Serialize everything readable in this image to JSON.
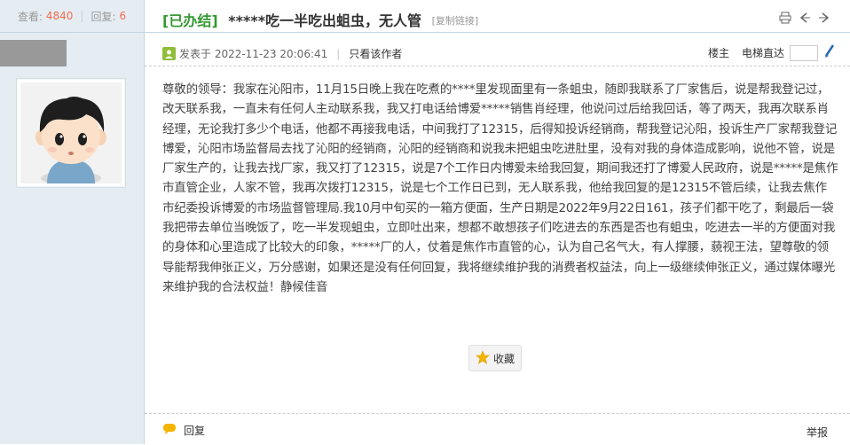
{
  "stats": {
    "views_label": "查看:",
    "views_count": "4840",
    "replies_label": "回复:",
    "replies_count": "6"
  },
  "thread": {
    "status_tag": "[已办结]",
    "title": "*****吃一半吃出蛆虫，无人管",
    "copy_link": "[复制链接]"
  },
  "post_meta": {
    "posted_at": "发表于 2022-11-23 20:06:41",
    "only_author": "只看该作者",
    "floor_owner": "楼主",
    "elevator": "电梯直达"
  },
  "post": {
    "body": "尊敬的领导：我家在沁阳市，11月15日晚上我在吃煮的****里发现面里有一条蛆虫，随即我联系了厂家售后，说是帮我登记过，改天联系我，一直未有任何人主动联系我，我又打电话给博爱*****销售肖经理，他说问过后给我回话，等了两天，我再次联系肖经理，无论我打多少个电话，他都不再接我电话，中间我打了12315，后得知投诉经销商，帮我登记沁阳，投诉生产厂家帮我登记博爱，沁阳市场监督局去找了沁阳的经销商，沁阳的经销商和说我未把蛆虫吃进肚里，没有对我的身体造成影响，说他不管，说是厂家生产的，让我去找厂家，我又打了12315，说是7个工作日内博爱未给我回复，期间我还打了博爱人民政府，说是*****是焦作市直管企业，人家不管，我再次拨打12315，说是七个工作日已到，无人联系我，他给我回复的是12315不管后续，让我去焦作市纪委投诉博爱的市场监督管理局.我10月中旬买的一箱方便面，生产日期是2022年9月22日161，孩子们都干吃了，剩最后一袋我把带去单位当晚饭了，吃一半发现蛆虫，立即吐出来，想都不敢想孩子们吃进去的东西是否也有蛆虫，吃进去一半的方便面对我的身体和心里造成了比较大的印象，*****厂的人，仗着是焦作市直管的心，认为自己名气大，有人撑腰，藐视王法，望尊敬的领导能帮我伸张正义，万分感谢，如果还是没有任何回复，我将继续维护我的消费者权益法，向上一级继续伸张正义，通过媒体曝光来维护我的合法权益！静候佳音"
  },
  "actions": {
    "favorite": "收藏",
    "reply": "回复",
    "report": "举报"
  },
  "colors": {
    "accent_green": "#339933",
    "count_orange": "#f26c4f",
    "sidebar_bg": "#e5edf2"
  }
}
